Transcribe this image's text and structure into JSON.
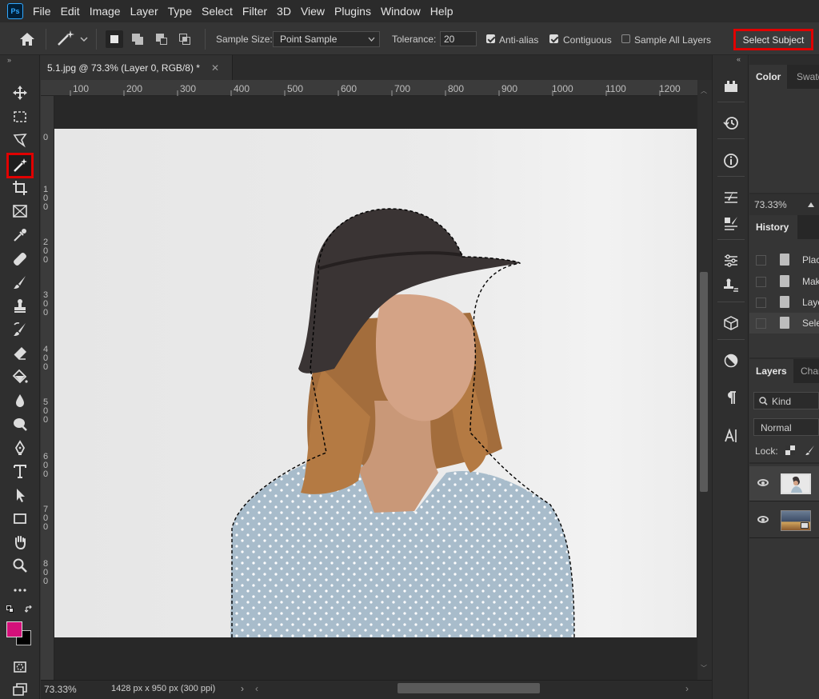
{
  "menu": {
    "items": [
      "File",
      "Edit",
      "Image",
      "Layer",
      "Type",
      "Select",
      "Filter",
      "3D",
      "View",
      "Plugins",
      "Window",
      "Help"
    ]
  },
  "options": {
    "sample_size_label": "Sample Size:",
    "sample_size_value": "Point Sample",
    "tolerance_label": "Tolerance:",
    "tolerance_value": "20",
    "anti_alias": "Anti-alias",
    "contiguous": "Contiguous",
    "sample_all_layers": "Sample All Layers",
    "select_subject": "Select Subject",
    "anti_alias_checked": true,
    "contiguous_checked": true,
    "sample_all_layers_checked": false
  },
  "document": {
    "tab_title": "5.1.jpg @ 73.3% (Layer 0, RGB/8) *",
    "ruler_top": [
      "100",
      "200",
      "300",
      "400",
      "500",
      "600",
      "700",
      "800",
      "900",
      "1000",
      "1100",
      "1200"
    ],
    "ruler_left": [
      "0",
      "1 0 0",
      "2 0 0",
      "3 0 0",
      "4 0 0",
      "5 0 0",
      "6 0 0",
      "7 0 0",
      "8 0 0"
    ]
  },
  "status": {
    "zoom": "73.33%",
    "doc_info": "1428 px x 950 px (300 ppi)"
  },
  "panels": {
    "color_tabs": [
      "Color",
      "Swatches"
    ],
    "nav_zoom": "73.33%",
    "history_tab": "History",
    "history_items": [
      "Place",
      "Make",
      "Layer",
      "Select"
    ],
    "layers_tabs": [
      "Layers",
      "Channels"
    ],
    "kind_search": "Kind",
    "blend_mode": "Normal",
    "lock_label": "Lock:"
  },
  "colors": {
    "foreground": "#d4107a",
    "background": "#000000",
    "highlight": "#e00000"
  },
  "icons": [
    "home-icon",
    "magic-wand-icon",
    "move-tool-icon",
    "marquee-tool-icon",
    "lasso-tool-icon",
    "crop-tool-icon",
    "frame-tool-icon",
    "eyedropper-tool-icon",
    "healing-brush-icon",
    "brush-tool-icon",
    "clone-stamp-icon",
    "history-brush-icon",
    "eraser-tool-icon",
    "paint-bucket-icon",
    "blur-tool-icon",
    "dodge-tool-icon",
    "pen-tool-icon",
    "type-tool-icon",
    "path-selection-icon",
    "rectangle-tool-icon",
    "hand-tool-icon",
    "zoom-tool-icon",
    "more-tools-icon"
  ]
}
